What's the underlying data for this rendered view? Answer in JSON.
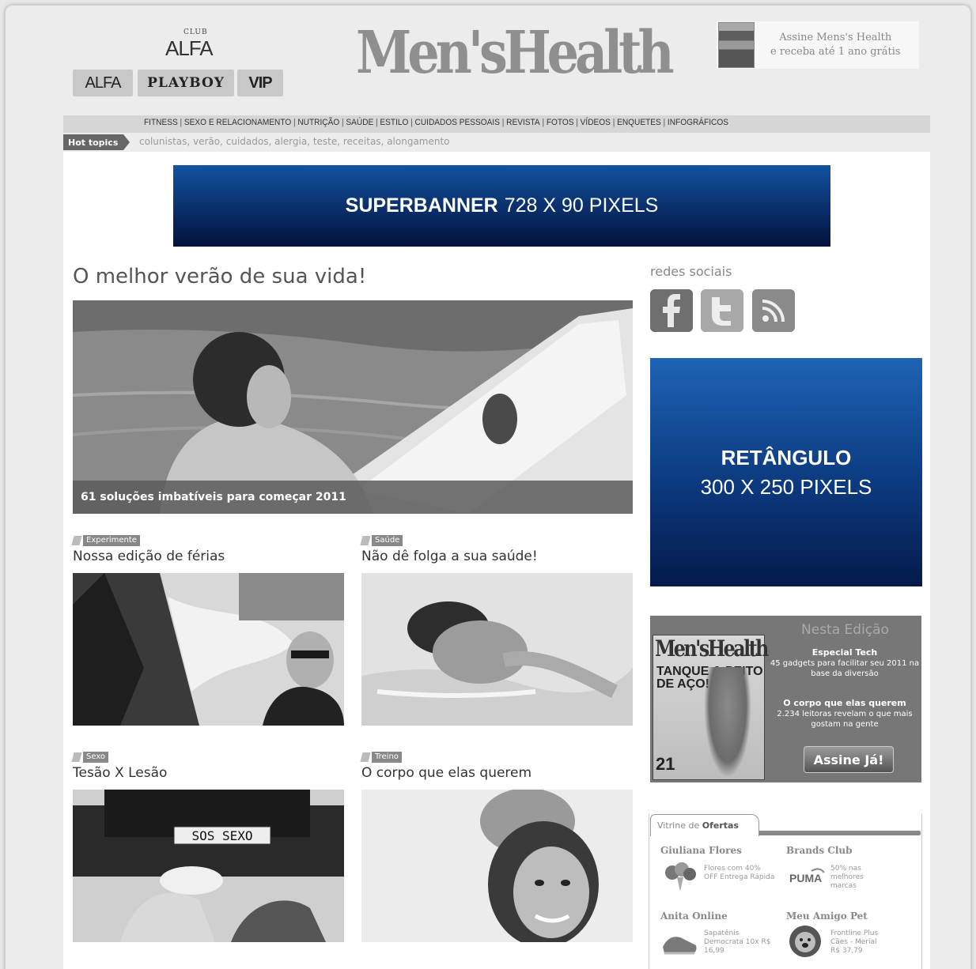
{
  "header": {
    "club_top": "CLUB",
    "club_alfa": "ALFA",
    "brands": [
      "ALFA",
      "PLAYBOY",
      "VIP"
    ],
    "logo": "Men'sHealth",
    "subscribe_line1": "Assine Mens's Health",
    "subscribe_line2": "e receba até 1 ano grátis"
  },
  "nav": {
    "items": [
      "FITNESS",
      "SEXO E RELACIONAMENTO",
      "NUTRIÇÃO",
      "SAÚDE",
      "ESTILO",
      "CUIDADOS PESSOAIS",
      "REVISTA",
      "FOTOS",
      "VÍDEOS",
      "ENQUETES",
      "INFOGRÁFICOS"
    ],
    "separator": "|",
    "hot_label": "Hot topics",
    "hot_topics": "colunistas, verão, cuidados, alergia, teste, receitas, alongamento"
  },
  "superbanner": {
    "bold": "SUPERBANNER",
    "size": "728 X 90 PIXELS"
  },
  "hero": {
    "title": "O melhor verão de sua vida!",
    "caption": "61 soluções imbatíveis para começar 2011"
  },
  "articles": [
    {
      "tag": "Experimente",
      "title": "Nossa edição de férias"
    },
    {
      "tag": "Saúde",
      "title": "Não dê folga a sua saúde!"
    },
    {
      "tag": "Sexo",
      "title": "Tesão X Lesão"
    },
    {
      "tag": "Treino",
      "title": "O corpo que elas querem"
    }
  ],
  "sidebar": {
    "redes_label": "redes sociais",
    "social": [
      "facebook-icon",
      "twitter-icon",
      "rss-icon"
    ],
    "retangulo_bold": "RETÂNGULO",
    "retangulo_size": "300 X 250 PIXELS",
    "nesta": {
      "heading": "Nesta Edição",
      "mag_logo": "Men'sHealth",
      "mag_headline": "TANQUE & PEITO DE AÇO!",
      "mag_number": "21",
      "item1_title": "Especial Tech",
      "item1_text": "45 gadgets para facilitar seu 2011 na base da diversão",
      "item2_title": "O corpo que elas querem",
      "item2_text": "2.234 leitoras revelam o que mais gostam na gente",
      "button": "Assine Já!"
    },
    "vitrine": {
      "tab_light": "Vitrine de",
      "tab_bold": "Ofertas",
      "shops": [
        {
          "name": "Giuliana Flores",
          "desc": "Flores com 40% OFF Entrega Rápida"
        },
        {
          "name": "Brands Club",
          "desc": "50% nas melhores marcas"
        },
        {
          "name": "Anita Online",
          "desc": "Sapatênis Democrata 10x R$ 16,99"
        },
        {
          "name": "Meu Amigo Pet",
          "desc": "Frontline Plus Cães - Merial R$ 37,79"
        }
      ]
    }
  },
  "license_plate": "SOS SEXO"
}
